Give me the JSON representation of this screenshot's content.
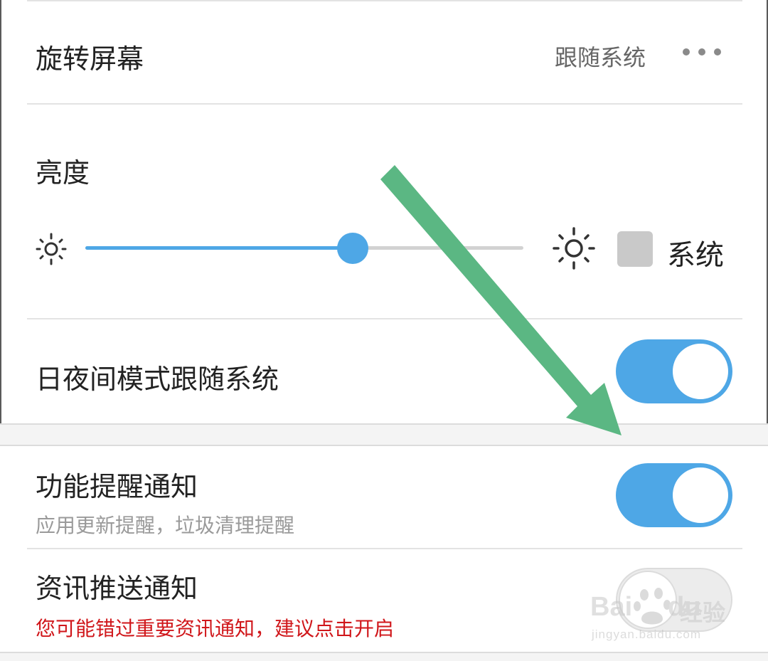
{
  "rotate_screen": {
    "title": "旋转屏幕",
    "value": "跟随系统"
  },
  "brightness": {
    "title": "亮度",
    "level": 0.61,
    "system_checkbox_label": "系统",
    "system_checked": false
  },
  "day_night_follow_system": {
    "title": "日夜间模式跟随系统",
    "enabled": true
  },
  "feature_reminder": {
    "title": "功能提醒通知",
    "subtitle": "应用更新提醒，垃圾清理提醒",
    "enabled": true
  },
  "news_push": {
    "title": "资讯推送通知",
    "warning": "您可能错过重要资讯通知，建议点击开启",
    "enabled": false
  },
  "colors": {
    "accent": "#4ea7e6",
    "warning": "#d0161a",
    "annotation_arrow": "#5bb783",
    "toggle_off": "#ececec"
  },
  "icons": {
    "brightness_low": "sun-small-icon",
    "brightness_high": "sun-large-icon",
    "more": "more-dots-icon"
  },
  "watermark": {
    "brand": "Bai",
    "brand_tail": "du",
    "product": "经验",
    "url": "jingyan.baidu.com"
  }
}
